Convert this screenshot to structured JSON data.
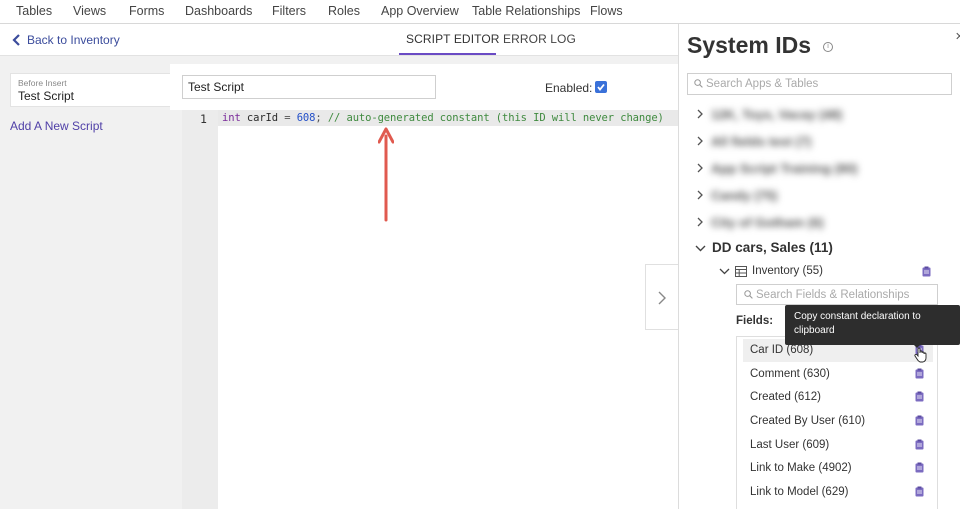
{
  "top_nav": {
    "items": [
      "Tables",
      "Views",
      "Forms",
      "Dashboards",
      "Filters",
      "Roles",
      "App Overview",
      "Table Relationships",
      "Flows"
    ]
  },
  "subheader": {
    "back_label": "Back to Inventory",
    "tabs": [
      {
        "label": "SCRIPT EDITOR",
        "active": true
      },
      {
        "label": "ERROR LOG",
        "active": false
      }
    ]
  },
  "scripts": {
    "selected_event": "Before Insert",
    "selected_name": "Test Script",
    "add_label": "Add A New Script"
  },
  "editor": {
    "name_value": "Test Script",
    "enabled_label": "Enabled:",
    "enabled": true,
    "line_number": "1",
    "code": {
      "keyword": "int",
      "variable": " carId",
      "operator": " = ",
      "number": "608",
      "semicolon": "; ",
      "comment": "// auto-generated constant (this ID will never change)"
    }
  },
  "system_ids": {
    "title": "System IDs",
    "search_placeholder": "Search Apps & Tables",
    "apps_collapsed": [
      "12K, Toys, Vacay (48)",
      "All fields test (7)",
      "App Script Training (80)",
      "Candy (75)",
      "City of Gotham (6)"
    ],
    "app_open": "DD cars, Sales (11)",
    "table": "Inventory (55)",
    "fields_search_placeholder": "Search Fields & Relationships",
    "fields_label": "Fields:",
    "fields": [
      "Car ID (608)",
      "Comment (630)",
      "Created (612)",
      "Created By User (610)",
      "Last User (609)",
      "Link to Make (4902)",
      "Link to Model (629)"
    ],
    "tooltip": "Copy constant declaration to clipboard"
  },
  "colors": {
    "accent": "#6a4bc4",
    "link": "#3b4c9c",
    "clipboard": "#7b6bc0",
    "arrow": "#e05a4f"
  }
}
